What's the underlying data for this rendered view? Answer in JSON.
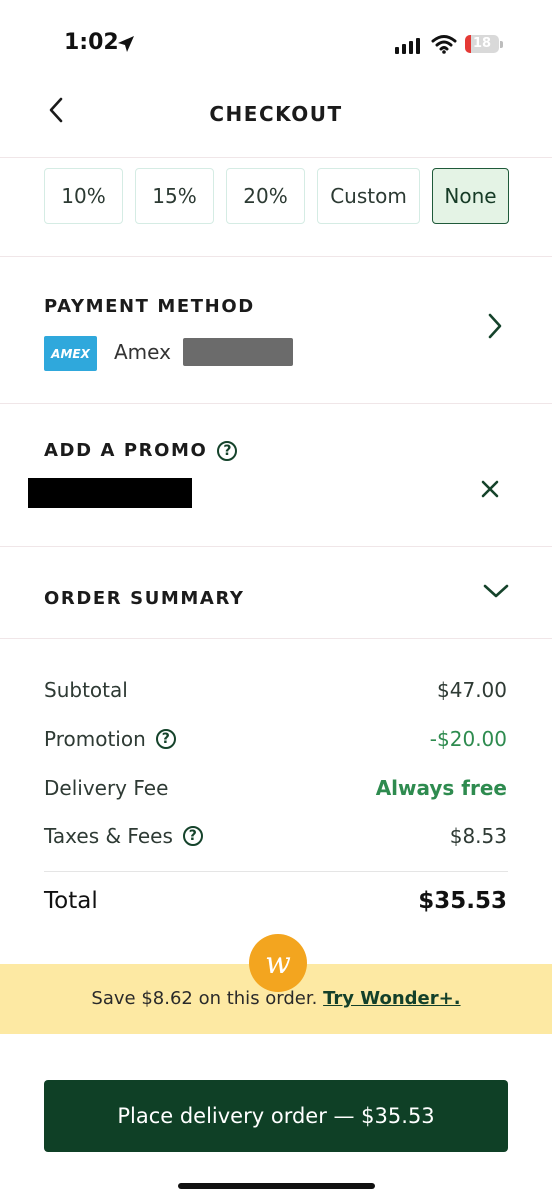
{
  "status_bar": {
    "time": "1:02",
    "battery": "18",
    "battery_level": 0.18,
    "battery_color": "#e53935"
  },
  "header": {
    "title": "CHECKOUT"
  },
  "tip": {
    "options": [
      "10%",
      "15%",
      "20%",
      "Custom",
      "None"
    ],
    "selected": "None"
  },
  "payment": {
    "heading": "PAYMENT METHOD",
    "card_logo": "AMEX",
    "card_label": "Amex"
  },
  "promo": {
    "heading": "ADD A PROMO",
    "help": "?"
  },
  "order_summary": {
    "heading": "ORDER SUMMARY"
  },
  "summary": {
    "subtotal_label": "Subtotal",
    "subtotal_value": "$47.00",
    "promotion_label": "Promotion",
    "promotion_value": "-$20.00",
    "delivery_label": "Delivery Fee",
    "delivery_value": "Always free",
    "taxes_label": "Taxes & Fees",
    "taxes_value": "$8.53",
    "total_label": "Total",
    "total_value": "$35.53"
  },
  "banner": {
    "text": "Save $8.62 on this order.",
    "link": "Try Wonder+.",
    "badge_letter": "w"
  },
  "cta": {
    "label": "Place delivery order — $35.53"
  },
  "colors": {
    "brand_green": "#0f4026",
    "accent_green": "#2e8b4f",
    "banner": "#fde9a3",
    "badge": "#f3a51f",
    "amex": "#2fa8dc"
  },
  "icons": [
    "location-arrow-icon",
    "signal-icon",
    "wifi-icon",
    "battery-icon",
    "back-chevron-icon",
    "chevron-right-icon",
    "close-icon",
    "chevron-down-icon",
    "help-icon",
    "wonder-logo-icon",
    "amex-logo-icon"
  ]
}
